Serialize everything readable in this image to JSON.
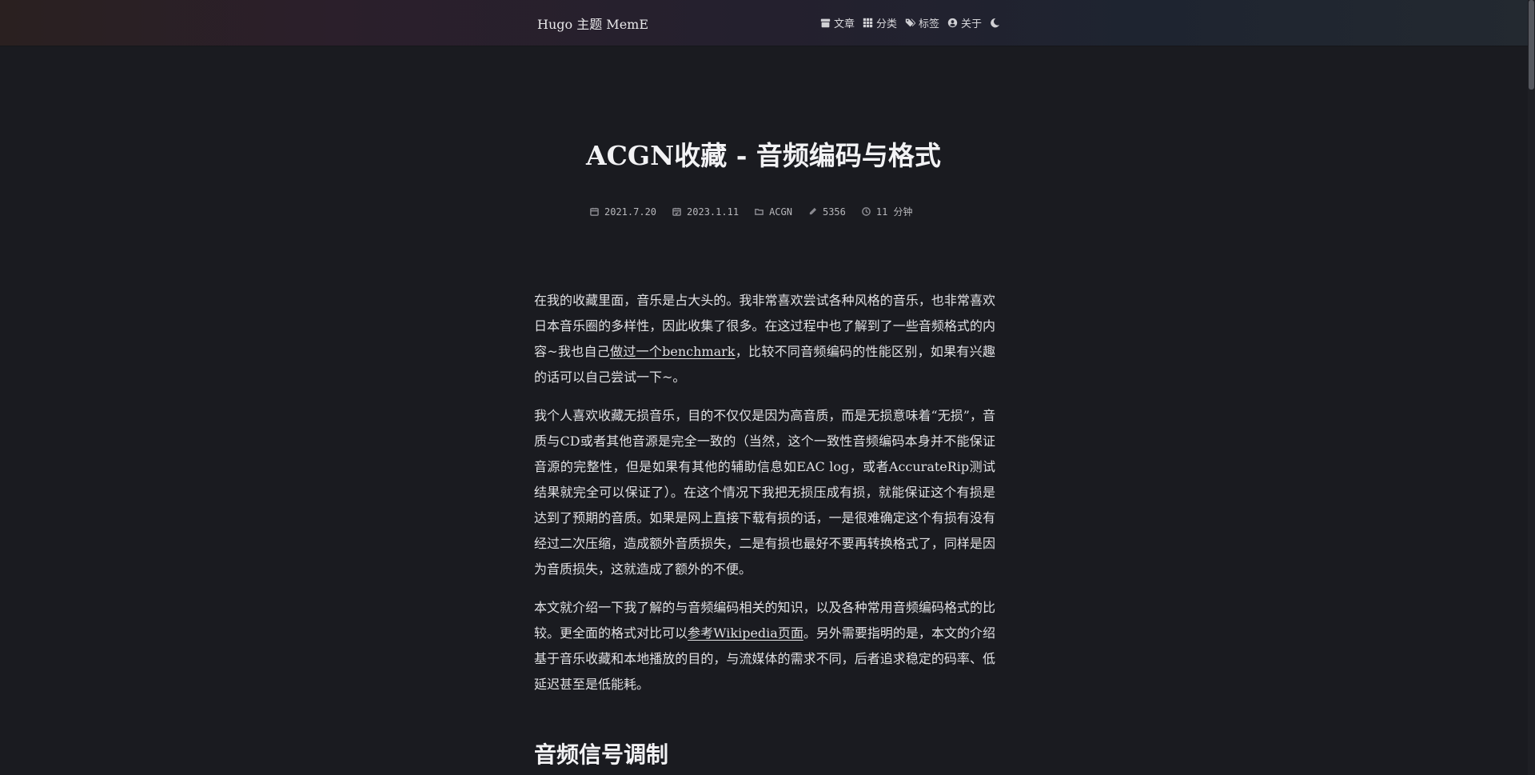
{
  "header": {
    "brand": "Hugo 主题 MemE",
    "nav": [
      {
        "label": "文章",
        "icon": "archive-icon"
      },
      {
        "label": "分类",
        "icon": "grid-icon"
      },
      {
        "label": "标签",
        "icon": "tags-icon"
      },
      {
        "label": "关于",
        "icon": "user-circle-icon"
      }
    ],
    "theme_toggle_icon": "moon-icon"
  },
  "post": {
    "title": "ACGN收藏 - 音频编码与格式",
    "meta": {
      "published": "2021.7.20",
      "updated": "2023.1.11",
      "category": "ACGN",
      "word_count": "5356",
      "reading_time": "11 分钟"
    },
    "paragraphs": [
      {
        "before": "在我的收藏里面，音乐是占大头的。我非常喜欢尝试各种风格的音乐，也非常喜欢日本音乐圈的多样性，因此收集了很多。在这过程中也了解到了一些音频格式的内容~我也自己",
        "link": "做过一个benchmark",
        "after": "，比较不同音频编码的性能区别，如果有兴趣的话可以自己尝试一下~。"
      },
      {
        "text": "我个人喜欢收藏无损音乐，目的不仅仅是因为高音质，而是无损意味着“无损”，音质与CD或者其他音源是完全一致的（当然，这个一致性音频编码本身并不能保证音源的完整性，但是如果有其他的辅助信息如EAC log，或者AccurateRip测试结果就完全可以保证了）。在这个情况下我把无损压成有损，就能保证这个有损是达到了预期的音质。如果是网上直接下载有损的话，一是很难确定这个有损有没有经过二次压缩，造成额外音质损失，二是有损也最好不要再转换格式了，同样是因为音质损失，这就造成了额外的不便。"
      },
      {
        "before": "本文就介绍一下我了解的与音频编码相关的知识，以及各种常用音频编码格式的比较。更全面的格式对比可以",
        "link": "参考Wikipedia页面",
        "after": "。另外需要指明的是，本文的介绍基于音乐收藏和本地播放的目的，与流媒体的需求不同，后者追求稳定的码率、低延迟甚至是低能耗。"
      }
    ],
    "section_heading": "音频信号调制"
  },
  "colors": {
    "background": "#1a1b20",
    "text": "#e0e0e3",
    "meta_text": "#b8b8bc"
  }
}
